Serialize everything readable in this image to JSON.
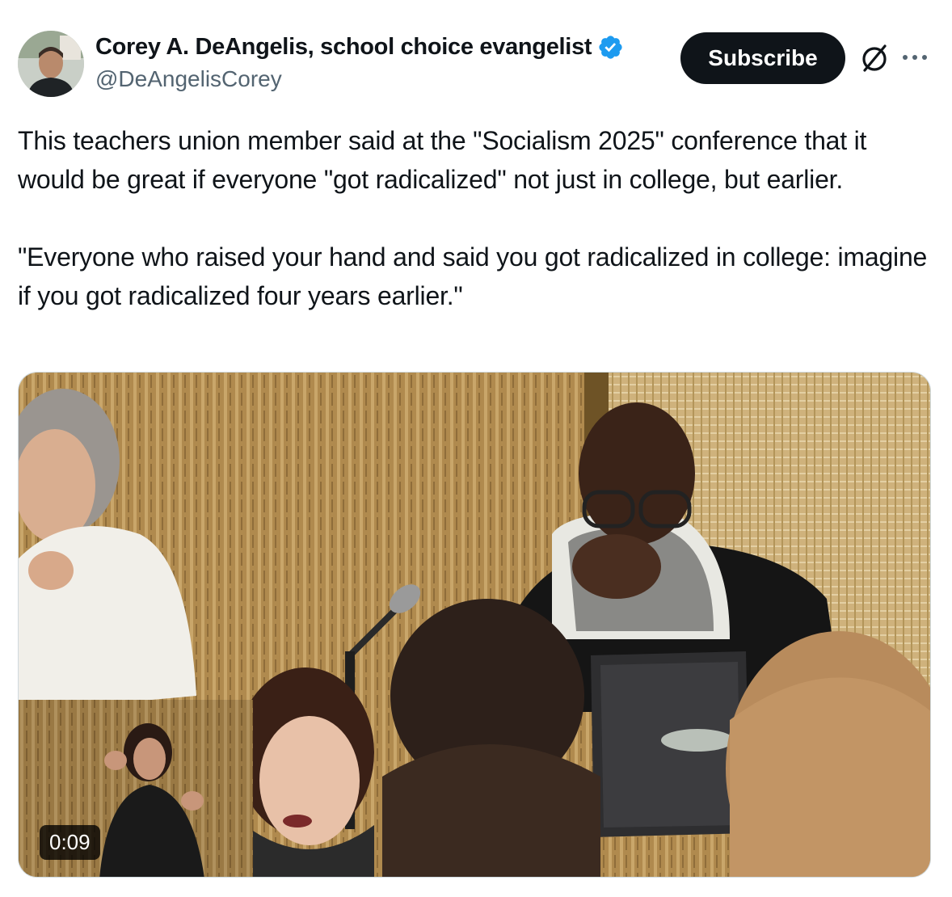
{
  "author": {
    "display_name": "Corey A. DeAngelis, school choice evangelist",
    "handle": "@DeAngelisCorey",
    "verified": true,
    "avatar_icon": "profile-avatar"
  },
  "actions": {
    "subscribe_label": "Subscribe",
    "grok_icon": "grok-icon",
    "more_icon": "more-options-icon"
  },
  "tweet": {
    "paragraphs": [
      "This teachers union member said at the \"Socialism 2025\" conference that it would be great if everyone \"got radicalized\" not just in college, but earlier.",
      "\"Everyone who raised your hand and said you got radicalized in college: imagine if you got radicalized four years earlier.\""
    ]
  },
  "media": {
    "type": "video",
    "duration": "0:09"
  },
  "colors": {
    "text": "#0f1419",
    "secondary_text": "#536471",
    "verified_blue": "#1d9bf0",
    "button_bg": "#0f1419"
  }
}
